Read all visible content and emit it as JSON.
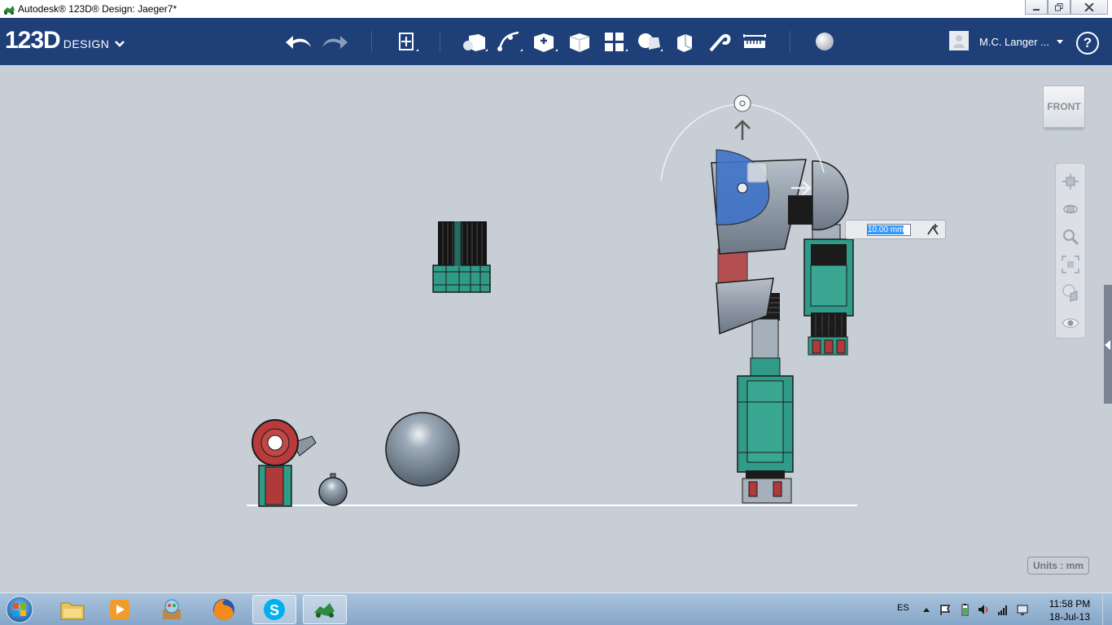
{
  "window": {
    "title": "Autodesk® 123D® Design: Jaeger7*",
    "controls": [
      "minimize",
      "maximize",
      "close"
    ]
  },
  "toolbar": {
    "logo_main": "123D",
    "logo_sub": "DESIGN",
    "tools": [
      "undo-icon",
      "redo-icon",
      "transform-icon",
      "primitives-icon",
      "sketch-icon",
      "construct-icon",
      "modify-icon",
      "pattern-icon",
      "grouping-icon",
      "combine-icon",
      "measure-snap-icon",
      "ruler-icon",
      "material-icon"
    ],
    "user_name": "M.C. Langer ...",
    "help_label": "?",
    "accent_color": "#1e3f77"
  },
  "viewport": {
    "viewcube_label": "FRONT",
    "units_label": "Units : mm",
    "dimension_value": "10.00 mm",
    "background_color": "#c8ced6"
  },
  "navbar": {
    "tools": [
      "pan-icon",
      "orbit-icon",
      "zoom-icon",
      "fit-icon",
      "views-icon",
      "visibility-icon"
    ]
  },
  "taskbar": {
    "apps": [
      "explorer",
      "media-player",
      "paint-app",
      "firefox",
      "skype",
      "123d-design"
    ],
    "language": "ES",
    "time": "11:58 PM",
    "date": "18-Jul-13"
  }
}
